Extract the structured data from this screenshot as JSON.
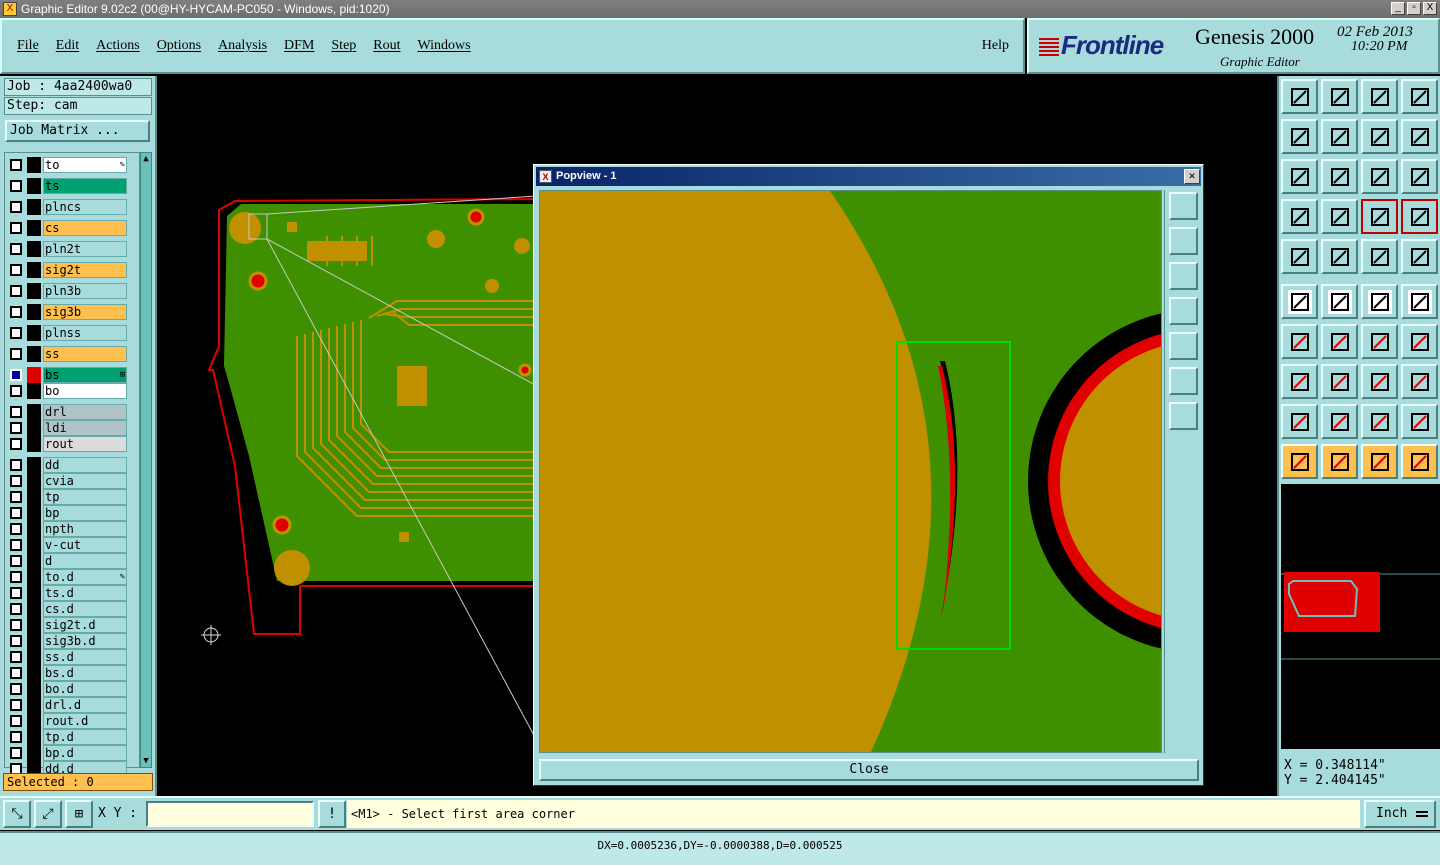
{
  "window": {
    "title": "Graphic Editor 9.02c2 (00@HY-HYCAM-PC050 - Windows, pid:1020)",
    "controls": [
      "_",
      "▫",
      "X"
    ]
  },
  "menubar": {
    "items": [
      "File",
      "Edit",
      "Actions",
      "Options",
      "Analysis",
      "DFM",
      "Step",
      "Rout",
      "Windows"
    ],
    "help": "Help"
  },
  "logo": {
    "brand": "Frontline",
    "product": "Genesis 2000",
    "subtitle": "Graphic Editor",
    "date": "02 Feb 2013",
    "time": "10:20 PM"
  },
  "job": {
    "job_line": "Job : 4aa2400wa0",
    "step_line": "Step: cam",
    "matrix_button": "Job Matrix ..."
  },
  "layers": [
    {
      "name": "to",
      "color": "#ffffff",
      "mark": "✎"
    },
    {
      "name": "ts",
      "color": "#00a070"
    },
    {
      "name": "plncs",
      "color": "#a8dcdc"
    },
    {
      "name": "cs",
      "color": "#ffc050"
    },
    {
      "name": "pln2t",
      "color": "#a8dcdc"
    },
    {
      "name": "sig2t",
      "color": "#ffc050"
    },
    {
      "name": "pln3b",
      "color": "#a8dcdc"
    },
    {
      "name": "sig3b",
      "color": "#ffc050"
    },
    {
      "name": "plnss",
      "color": "#a8dcdc"
    },
    {
      "name": "ss",
      "color": "#ffc050"
    },
    {
      "name": "bs",
      "color": "#00a070",
      "active": true,
      "mark": "⊞"
    },
    {
      "name": "bo",
      "color": "#ffffff"
    },
    {
      "name": "drl",
      "color": "#b0c4c8"
    },
    {
      "name": "ldi",
      "color": "#b0c4c8"
    },
    {
      "name": "rout",
      "color": "#dcdcdc"
    },
    {
      "name": "dd",
      "color": "#a8dcdc"
    },
    {
      "name": "cvia",
      "color": "#a8dcdc"
    },
    {
      "name": "tp",
      "color": "#a8dcdc"
    },
    {
      "name": "bp",
      "color": "#a8dcdc"
    },
    {
      "name": "npth",
      "color": "#a8dcdc"
    },
    {
      "name": "v-cut",
      "color": "#a8dcdc"
    },
    {
      "name": "d",
      "color": "#a8dcdc"
    },
    {
      "name": "to.d",
      "color": "#a8dcdc",
      "mark": "✎"
    },
    {
      "name": "ts.d",
      "color": "#a8dcdc"
    },
    {
      "name": "cs.d",
      "color": "#a8dcdc"
    },
    {
      "name": "sig2t.d",
      "color": "#a8dcdc"
    },
    {
      "name": "sig3b.d",
      "color": "#a8dcdc"
    },
    {
      "name": "ss.d",
      "color": "#a8dcdc"
    },
    {
      "name": "bs.d",
      "color": "#a8dcdc"
    },
    {
      "name": "bo.d",
      "color": "#a8dcdc"
    },
    {
      "name": "drl.d",
      "color": "#a8dcdc"
    },
    {
      "name": "rout.d",
      "color": "#a8dcdc"
    },
    {
      "name": "tp.d",
      "color": "#a8dcdc"
    },
    {
      "name": "bp.d",
      "color": "#a8dcdc"
    },
    {
      "name": "dd.d",
      "color": "#a8dcdc"
    }
  ],
  "selected_label": "Selected : 0",
  "popview": {
    "title": "Popview - 1",
    "close_button": "Close"
  },
  "coords": {
    "x": "X = 0.348114\"",
    "y": "Y = 2.404145\""
  },
  "bottom": {
    "xy_label": "X Y :",
    "xy_value": "",
    "prompt": "<M1> - Select first area corner",
    "unit": "Inch"
  },
  "status": "DX=0.0005236,DY=-0.0000388,D=0.000525",
  "colors": {
    "panel": "#a8dcdc",
    "board_green": "#3f9000",
    "copper": "#c09000",
    "outline_red": "#e00000"
  }
}
